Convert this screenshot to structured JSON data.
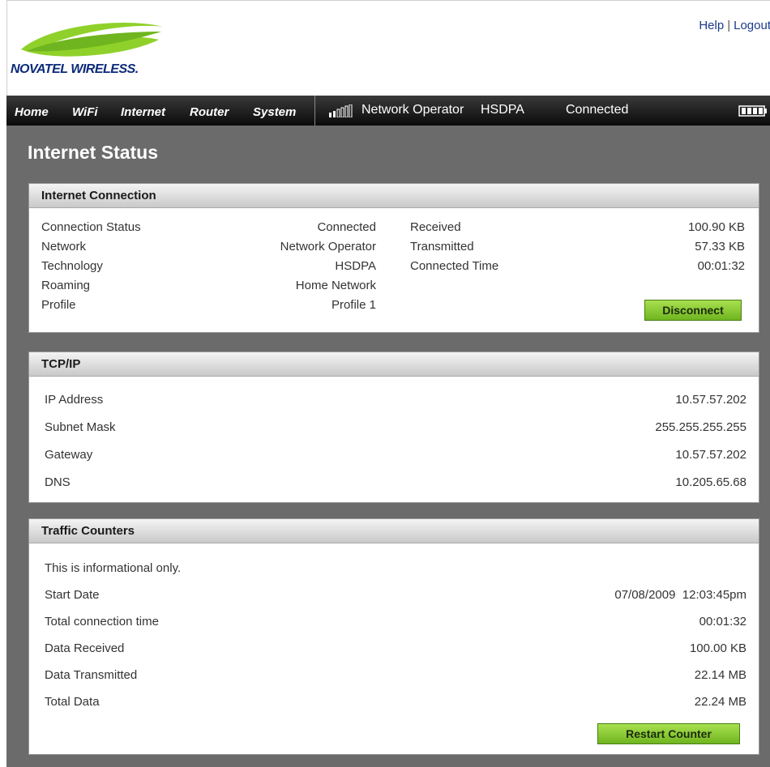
{
  "brand": {
    "name": "NOVATEL WIRELESS."
  },
  "top_links": {
    "help": "Help",
    "separator": "|",
    "logout": "Logout"
  },
  "nav": {
    "items": [
      "Home",
      "WiFi",
      "Internet",
      "Router",
      "System"
    ],
    "operator": "Network Operator",
    "technology": "HSDPA",
    "status": "Connected",
    "signal_icon": "signal-bars-icon",
    "battery_icon": "battery-icon"
  },
  "page": {
    "title": "Internet Status"
  },
  "internet_connection": {
    "title": "Internet Connection",
    "left": [
      {
        "label": "Connection Status",
        "value": "Connected"
      },
      {
        "label": "Network",
        "value": "Network Operator"
      },
      {
        "label": "Technology",
        "value": "HSDPA"
      },
      {
        "label": "Roaming",
        "value": "Home Network"
      },
      {
        "label": "Profile",
        "value": "Profile 1"
      }
    ],
    "right": [
      {
        "label": "Received",
        "value": "100.90 KB"
      },
      {
        "label": "Transmitted",
        "value": "57.33 KB"
      },
      {
        "label": "Connected Time",
        "value": "00:01:32"
      }
    ],
    "button": "Disconnect"
  },
  "tcpip": {
    "title": "TCP/IP",
    "rows": [
      {
        "label": "IP Address",
        "value": "10.57.57.202"
      },
      {
        "label": "Subnet Mask",
        "value": "255.255.255.255"
      },
      {
        "label": "Gateway",
        "value": "10.57.57.202"
      },
      {
        "label": "DNS",
        "value": "10.205.65.68"
      }
    ]
  },
  "traffic": {
    "title": "Traffic Counters",
    "note": "This is informational only.",
    "rows": [
      {
        "label": "Start Date",
        "value": "07/08/2009  12:03:45pm"
      },
      {
        "label": "Total connection time",
        "value": "00:01:32"
      },
      {
        "label": "Data Received",
        "value": "100.00 KB"
      },
      {
        "label": "Data Transmitted",
        "value": "22.14 MB"
      },
      {
        "label": "Total Data",
        "value": "22.24 MB"
      }
    ],
    "button": "Restart Counter"
  },
  "colors": {
    "brand_green": "#9acd32",
    "brand_blue": "#0b2a7a",
    "button_green": "#8ccc3a",
    "background": "#6b6b6b"
  }
}
